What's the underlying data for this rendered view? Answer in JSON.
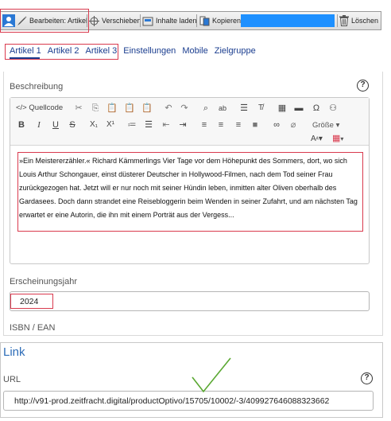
{
  "toolbar": {
    "edit_label": "Bearbeiten: Artikel",
    "move_label": "Verschieben",
    "load_label": "Inhalte laden",
    "copy_label": "Kopieren",
    "delete_label": "Löschen"
  },
  "tabs": [
    {
      "label": "Artikel 1"
    },
    {
      "label": "Artikel 2"
    },
    {
      "label": "Artikel 3"
    },
    {
      "label": "Einstellungen"
    },
    {
      "label": "Mobile"
    },
    {
      "label": "Zielgruppe"
    }
  ],
  "description": {
    "label": "Beschreibung",
    "source_label": "Quellcode",
    "size_label": "Größe",
    "text": "»Ein Meistererzähler.« Richard Kämmerlings Vier Tage vor dem Höhepunkt des Sommers, dort, wo sich Louis Arthur Schongauer, einst düsterer Deutscher in Hollywood-Filmen, nach dem Tod seiner Frau zurückgezogen hat. Jetzt will er nur noch mit seiner Hündin leben, inmitten alter Oliven oberhalb des Gardasees. Doch dann strandet eine Reisebloggerin beim Wenden in seiner Zufahrt, und am nächsten Tag erwartet er eine Autorin, die ihn mit einem Porträt aus der Vergess..."
  },
  "year": {
    "label": "Erscheinungsjahr",
    "value": "2024"
  },
  "isbn": {
    "label": "ISBN / EAN"
  },
  "link": {
    "title": "Link",
    "url_label": "URL",
    "url_value": "http://v91-prod.zeitfracht.digital/productOptivo/15705/10002/-3/409927646088323662"
  },
  "colors": {
    "accent_blue": "#1e90ff",
    "tab_blue": "#1a3d8f",
    "highlight_red": "#d93a4e",
    "check_green": "#5aa832"
  }
}
